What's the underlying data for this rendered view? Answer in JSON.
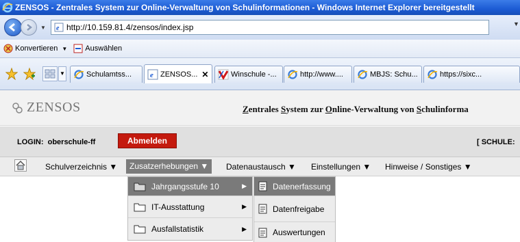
{
  "window": {
    "title": "ZENSOS - Zentrales System zur Online-Verwaltung von Schulinformationen - Windows Internet Explorer bereitgestellt"
  },
  "address": {
    "url": "http://10.159.81.4/zensos/index.jsp"
  },
  "toolbar": {
    "convert_label": "Konvertieren",
    "select_label": "Auswählen"
  },
  "tabs": [
    {
      "label": "Schulamtss..."
    },
    {
      "label": "ZENSOS..."
    },
    {
      "label": "Winschule -..."
    },
    {
      "label": "http://www...."
    },
    {
      "label": "MBJS: Schu..."
    },
    {
      "label": "https://sixc..."
    }
  ],
  "header": {
    "logo": "ZENSOS",
    "subtitle_parts": [
      {
        "u": "Z",
        "t": "entrales "
      },
      {
        "u": "S",
        "t": "ystem zur "
      },
      {
        "u": "O",
        "t": "nline-"
      },
      {
        "u": "",
        "t": "Verwaltung von "
      },
      {
        "u": "S",
        "t": "chulinforma"
      }
    ]
  },
  "login": {
    "label": "LOGIN:  oberschule-ff",
    "logout_label": "Abmelden",
    "school_label": "[ SCHULE:"
  },
  "menu": [
    {
      "label": "Schulverzeichnis ▼"
    },
    {
      "label": "Zusatzerhebungen ▼"
    },
    {
      "label": "Datenaustausch ▼"
    },
    {
      "label": "Einstellungen ▼"
    },
    {
      "label": "Hinweise / Sonstiges ▼"
    }
  ],
  "submenu": [
    {
      "label": "Jahrgangsstufe 10"
    },
    {
      "label": "IT-Ausstattung"
    },
    {
      "label": "Ausfallstatistik"
    }
  ],
  "submenu2": [
    {
      "label": "Datenerfassung"
    },
    {
      "label": "Datenfreigabe"
    },
    {
      "label": "Auswertungen"
    }
  ],
  "colors": {
    "titlebar": "#1c5bd4",
    "logout_button": "#c41a0e",
    "menu_active": "#7b7b7b"
  }
}
